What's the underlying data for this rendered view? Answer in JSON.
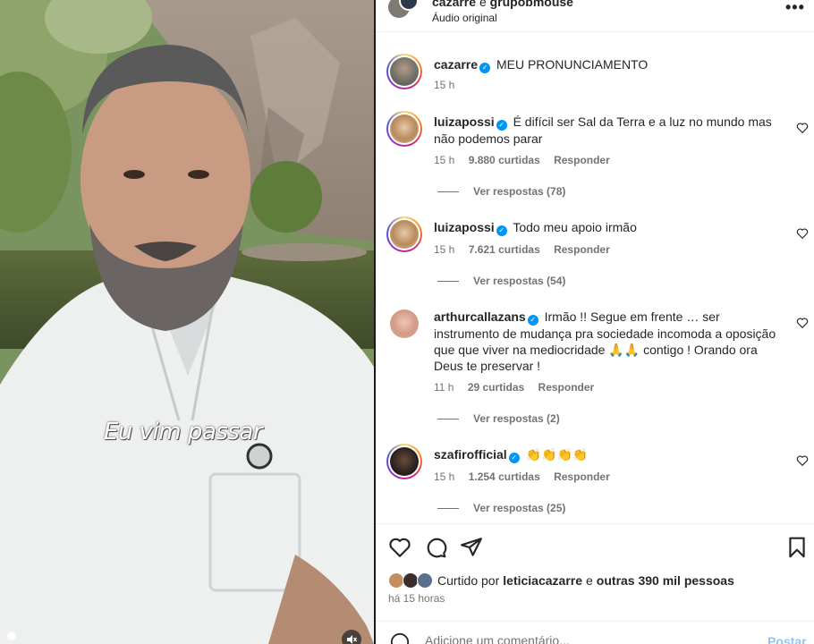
{
  "header": {
    "owner": "cazarre",
    "joiner": "e",
    "collaborator": "grupobmouse",
    "audio": "Áudio original",
    "more": "•••"
  },
  "media": {
    "caption": "Eu vim passar"
  },
  "post_caption": {
    "username": "cazarre",
    "text": "MEU PRONUNCIAMENTO",
    "time": "15 h"
  },
  "comments": [
    {
      "username": "luizapossi",
      "text": "É difícil ser Sal da Terra e a luz no mundo mas não podemos parar",
      "time": "15 h",
      "likes": "9.880 curtidas",
      "reply": "Responder",
      "view_replies": "Ver respostas (78)"
    },
    {
      "username": "luizapossi",
      "text": "Todo meu apoio irmão",
      "time": "15 h",
      "likes": "7.621 curtidas",
      "reply": "Responder",
      "view_replies": "Ver respostas (54)"
    },
    {
      "username": "arthurcallazans",
      "text": "Irmão !! Segue em frente … ser instrumento de mudança pra sociedade incomoda a oposição que que viver na mediocridade 🙏🙏 contigo ! Orando ora Deus te preservar !",
      "time": "11 h",
      "likes": "29 curtidas",
      "reply": "Responder",
      "view_replies": "Ver respostas (2)"
    },
    {
      "username": "szafirofficial",
      "text": "👏👏👏👏",
      "time": "15 h",
      "likes": "1.254 curtidas",
      "reply": "Responder",
      "view_replies": "Ver respostas (25)"
    }
  ],
  "likes_line": {
    "prefix": "Curtido por",
    "liker": "leticiacazarre",
    "middle": "e",
    "others": "outras 390 mil pessoas"
  },
  "time_ago": "há 15 horas",
  "add_comment": {
    "placeholder": "Adicione um comentário...",
    "post": "Postar"
  },
  "icons": [
    "heart-icon",
    "comment-icon",
    "share-icon",
    "bookmark-icon",
    "emoji-icon",
    "mute-icon",
    "verified-icon"
  ],
  "colors": {
    "verified": "#0095f6",
    "post_disabled": "#8ec5fb",
    "muted_text": "#737373"
  }
}
